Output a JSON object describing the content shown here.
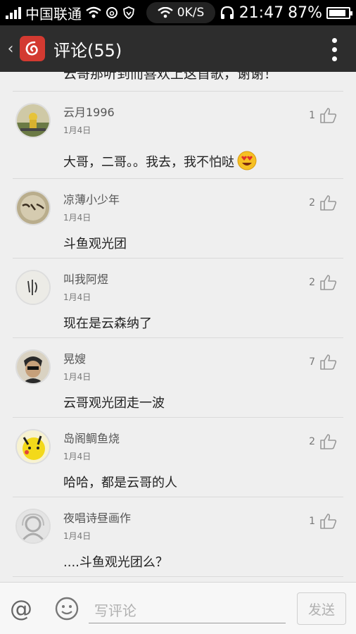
{
  "status_bar": {
    "carrier": "中国联通",
    "speed": "0K/S",
    "time": "21:47",
    "battery": "87%",
    "battery_level": 0.87
  },
  "header": {
    "title": "评论(55)"
  },
  "partial_comment": "云哥那听到而喜欢上这首歌，谢谢！",
  "comments": [
    {
      "user": "云月1996",
      "date": "1月4日",
      "text": "大哥，二哥。。我去，我不怕哒",
      "likes": "1",
      "emoji": "heart-eyes-emoji"
    },
    {
      "user": "凉薄小少年",
      "date": "1月4日",
      "text": "斗鱼观光团",
      "likes": "2"
    },
    {
      "user": "叫我阿煜",
      "date": "1月4日",
      "text": "现在是云森纳了",
      "likes": "2"
    },
    {
      "user": "晃嫂",
      "date": "1月4日",
      "text": "云哥观光团走一波",
      "likes": "7"
    },
    {
      "user": "岛阁鲷鱼烧",
      "date": "1月4日",
      "text": "哈哈，都是云哥的人",
      "likes": "2"
    },
    {
      "user": "夜唱诗昼画作",
      "date": "1月4日",
      "text": "....斗鱼观光团么？",
      "likes": "1"
    }
  ],
  "input": {
    "placeholder": "写评论",
    "send_label": "发送"
  },
  "colors": {
    "title_bar": "#2d2d2d",
    "brand_red": "#d33a31",
    "background": "#efefef"
  }
}
